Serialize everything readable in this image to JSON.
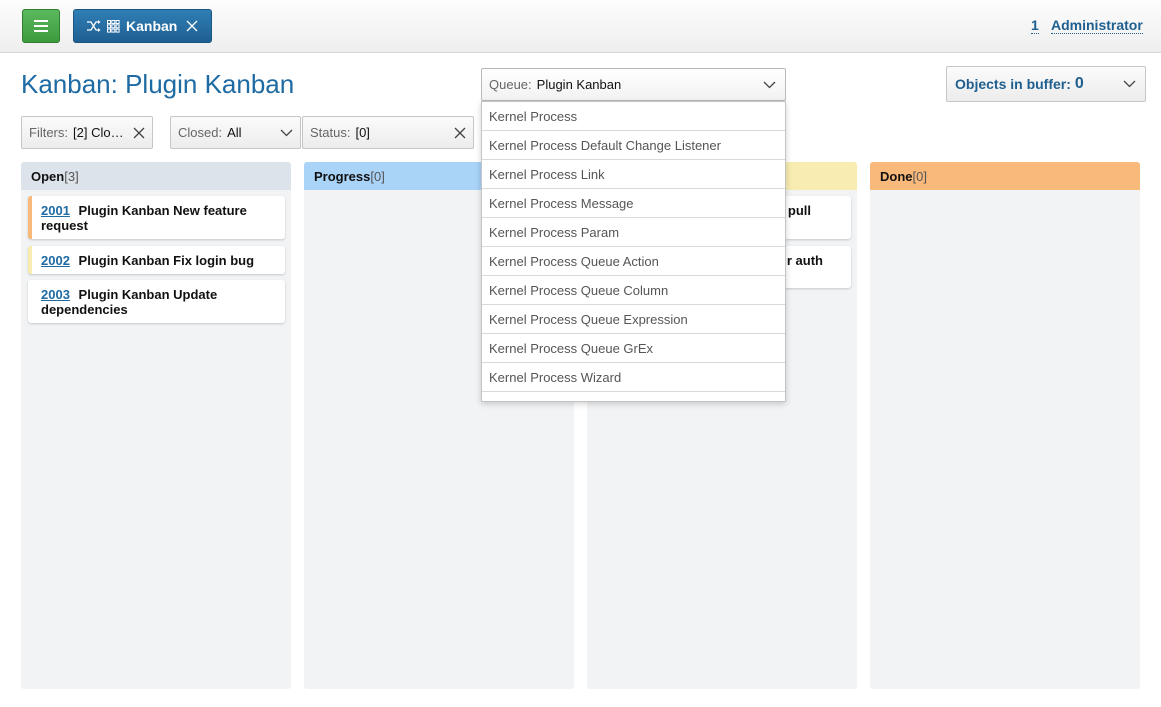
{
  "topbar": {
    "menu_icon": "hamburger-icon",
    "tab": {
      "label": "Kanban",
      "icons": [
        "shuffle-icon",
        "grid-icon",
        "close-icon"
      ]
    },
    "user": {
      "count": "1",
      "name": "Administrator"
    }
  },
  "header": {
    "title": "Kanban: Plugin Kanban",
    "queue": {
      "label": "Queue:",
      "value": "Plugin Kanban"
    },
    "buffer": {
      "label": "Objects in buffer:",
      "value": "0"
    }
  },
  "filters": [
    {
      "label": "Filters:",
      "value": "[2] Clo…"
    },
    {
      "label": "Closed:",
      "value": "All"
    },
    {
      "label": "Status:",
      "value": "[0]"
    }
  ],
  "columns": [
    {
      "name": "Open",
      "count": "[3]",
      "color": "#dde3ea",
      "cards": [
        {
          "id": "2001",
          "title": "Plugin Kanban New feature request",
          "accent": "#f9b97a"
        },
        {
          "id": "2002",
          "title": "Plugin Kanban Fix login bug",
          "accent": "#f8ecb0"
        },
        {
          "id": "2003",
          "title": "Plugin Kanban Update dependencies"
        }
      ]
    },
    {
      "name": "Progress",
      "count": "[0]",
      "color": "#a9d3f7",
      "cards": []
    },
    {
      "name": "",
      "count": "",
      "color": "#f8ecb0",
      "cards": [
        {
          "id": "",
          "title": "pull"
        },
        {
          "id": "",
          "title": "r auth"
        }
      ]
    },
    {
      "name": "Done",
      "count": "[0]",
      "color": "#f9b97a",
      "cards": []
    }
  ],
  "queue_dropdown": {
    "options": [
      "Kernel Process",
      "Kernel Process Default Change Listener",
      "Kernel Process Link",
      "Kernel Process Message",
      "Kernel Process Param",
      "Kernel Process Queue Action",
      "Kernel Process Queue Column",
      "Kernel Process Queue Expression",
      "Kernel Process Queue GrEx",
      "Kernel Process Wizard"
    ]
  },
  "colors": {
    "accent": "#1e6aa3",
    "menu_green": "#4cae4c",
    "tab_blue": "#2a6fa6"
  }
}
